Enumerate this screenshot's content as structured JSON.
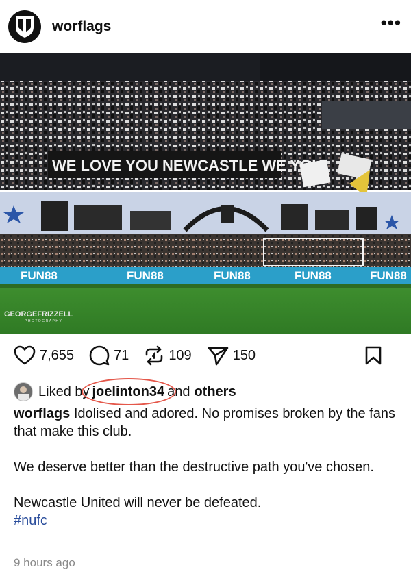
{
  "post": {
    "username": "worflags",
    "more_label": "•••",
    "photo": {
      "banner_text": "WE LOVE YOU NEWCASTLE WE YOU",
      "ad_text": "FUN88",
      "watermark_line1": "GEORGEFRIZZELL",
      "watermark_line2": "PHOTOGRAPHY"
    },
    "actions": {
      "likes": "7,655",
      "comments": "71",
      "reposts": "109",
      "shares": "150"
    },
    "liked_by": {
      "prefix": "Liked by",
      "user": "joelinton34",
      "suffix": "and",
      "others": "others"
    },
    "caption": {
      "username": "worflags",
      "line1": "Idolised and adored. No promises broken by the fans that make this club.",
      "line2": "We deserve better than the destructive path you've chosen.",
      "line3": "Newcastle United will never be defeated.",
      "hashtag": "#nufc"
    },
    "timestamp": "9 hours ago"
  }
}
